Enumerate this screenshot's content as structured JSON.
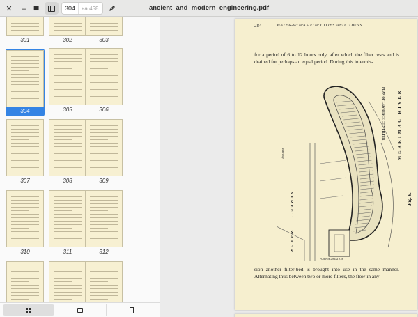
{
  "window": {
    "title": "ancient_and_modern_engineering.pdf",
    "close_glyph": "✕",
    "minimize_glyph": "‒",
    "maximize_glyph": "■"
  },
  "toolbar": {
    "current_page": "304",
    "page_of": "на 458",
    "sidebar_toggle_icon": "sidebar-icon",
    "edit_icon": "pencil-icon"
  },
  "sidebar": {
    "selected_color": "#3584e4",
    "thumbnails": [
      {
        "label": "301"
      },
      {
        "label": "302"
      },
      {
        "label": "303"
      },
      {
        "label": "304"
      },
      {
        "label": "305"
      },
      {
        "label": "306"
      },
      {
        "label": "307"
      },
      {
        "label": "308"
      },
      {
        "label": "309"
      },
      {
        "label": "310"
      },
      {
        "label": "311"
      },
      {
        "label": "312"
      },
      {
        "label": ""
      },
      {
        "label": ""
      },
      {
        "label": ""
      }
    ],
    "switcher": [
      "thumbnails-icon",
      "annotations-icon",
      "bookmarks-icon"
    ]
  },
  "document": {
    "page_number": "284",
    "running_head": "WATER-WORKS FOR CITIES AND TOWNS.",
    "text_top": "for a period of 6 to 12 hours only, after which the filter rests and is drained for perhaps an equal period.  During this intermis-",
    "text_bottom": "sion another filter-bed is brought into use in the same manner. Alternating thus between two or more filters, the flow in any",
    "figure": {
      "street": "STREET",
      "water": "WATER",
      "river": "MERRIMAC RIVER",
      "fig": "Fig. 6.",
      "plan_title": "PLAN OF LAWRENCE CITY FILTER",
      "pumping": "PUMPING STATION",
      "railway": "Railway"
    }
  }
}
